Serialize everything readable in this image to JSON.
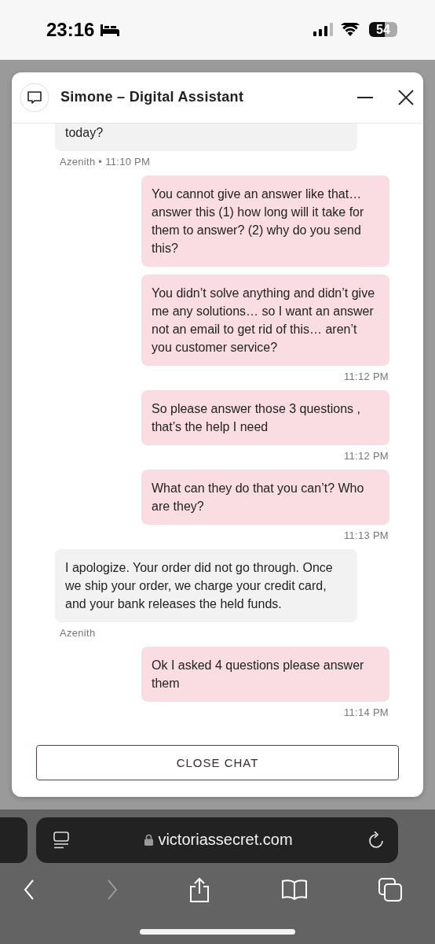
{
  "status_bar": {
    "time": "23:16",
    "battery": "54"
  },
  "chat": {
    "title": "Simone – Digital Assistant",
    "messages": [
      {
        "kind": "agent",
        "text": "today?",
        "meta": "Azenith • 11:10 PM"
      },
      {
        "kind": "user",
        "text": "You cannot give an answer like that… answer this (1) how long will it take for them to answer? (2) why do you send this?"
      },
      {
        "kind": "user",
        "text": "You didn’t solve anything and didn’t give me any solutions… so I want an answer not an email to get rid of this… aren’t you customer service?",
        "meta": "11:12 PM"
      },
      {
        "kind": "user",
        "text": "So please answer those 3 questions , that’s the help I need",
        "meta": "11:12 PM"
      },
      {
        "kind": "user",
        "text": "What can they do that you can’t? Who are they?",
        "meta": "11:13 PM"
      },
      {
        "kind": "agent",
        "text": "I apologize. Your order did not go through. Once we ship your order, we charge your credit card, and your bank releases the held funds.",
        "meta": "Azenith"
      },
      {
        "kind": "user",
        "text": "Ok I asked 4 questions please answer them",
        "meta": "11:14 PM"
      }
    ],
    "close_button": "CLOSE CHAT"
  },
  "browser": {
    "url": "victoriassecret.com",
    "forward_disabled": true
  }
}
